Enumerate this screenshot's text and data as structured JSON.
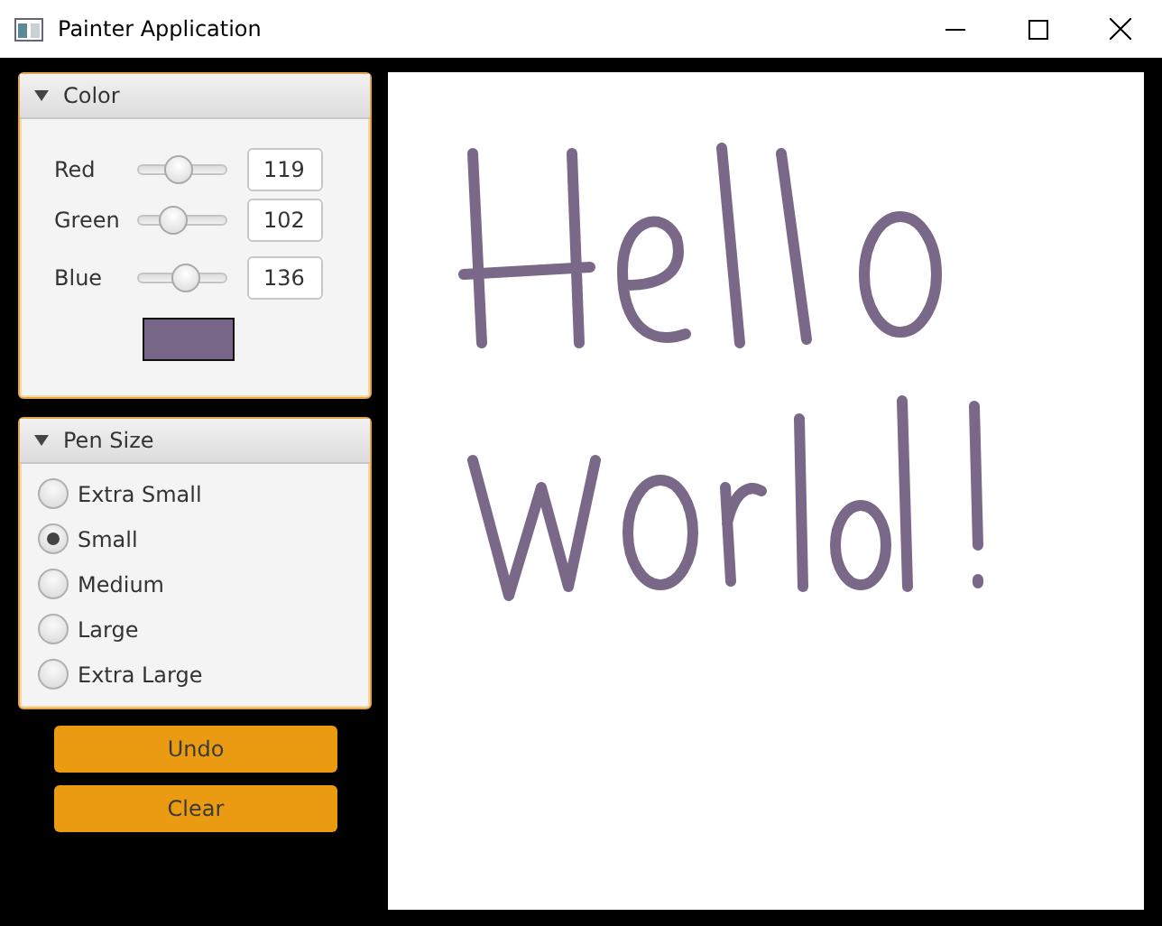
{
  "window": {
    "title": "Painter Application"
  },
  "color_panel": {
    "title": "Color",
    "expanded": true,
    "channels": [
      {
        "name": "Red",
        "value": "119",
        "level": 0.467
      },
      {
        "name": "Green",
        "value": "102",
        "level": 0.4
      },
      {
        "name": "Blue",
        "value": "136",
        "level": 0.533
      }
    ]
  },
  "pen_size_panel": {
    "title": "Pen Size",
    "expanded": true,
    "options": [
      {
        "label": "Extra Small",
        "selected": false
      },
      {
        "label": "Small",
        "selected": true
      },
      {
        "label": "Medium",
        "selected": false
      },
      {
        "label": "Large",
        "selected": false
      },
      {
        "label": "Extra Large",
        "selected": false
      }
    ]
  },
  "buttons": [
    "Undo",
    "Clear"
  ]
}
